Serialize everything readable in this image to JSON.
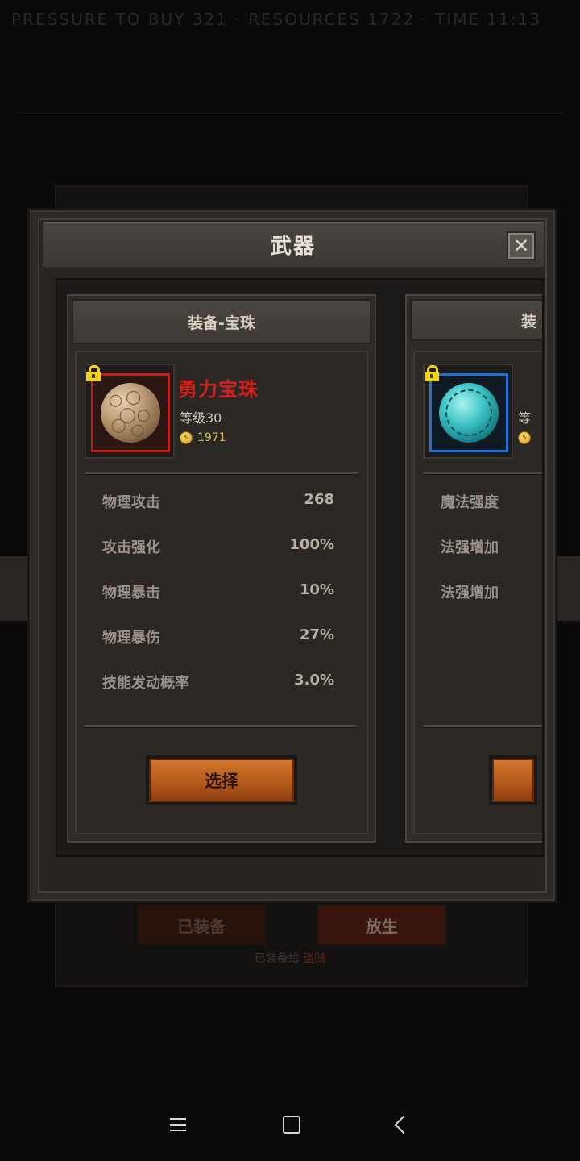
{
  "background": {
    "status_text": "PRESSURE TO BUY 321  ·  RESOURCES 1722  ·  TIME 11:13",
    "equipped_label": "已装备",
    "release_label": "放生",
    "equipped_to_prefix": "已装备给",
    "equipped_to_name": "盗贼"
  },
  "dialog": {
    "title": "武器",
    "close_glyph": "✕"
  },
  "cards": [
    {
      "header": "装备-宝珠",
      "name": "勇力宝珠",
      "level": "等级30",
      "price": "1971",
      "frame_color": "#c0201c",
      "locked": true,
      "stats": [
        {
          "label": "物理攻击",
          "value": "268"
        },
        {
          "label": "攻击强化",
          "value": "100%"
        },
        {
          "label": "物理暴击",
          "value": "10%"
        },
        {
          "label": "物理暴伤",
          "value": "27%"
        },
        {
          "label": "技能发动概率",
          "value": "3.0%"
        }
      ],
      "button": "选择"
    },
    {
      "header": "装",
      "name": "",
      "level": "等",
      "price": "",
      "frame_color": "#1f6fd6",
      "locked": true,
      "stats": [
        {
          "label": "魔法强度"
        },
        {
          "label": "法强增加"
        },
        {
          "label": "法强增加"
        }
      ]
    }
  ],
  "icons": {
    "lock": "lock-icon",
    "coin": "coin-icon",
    "close": "close-icon",
    "nav_menu": "menu-icon",
    "nav_home": "home-icon",
    "nav_back": "back-icon"
  }
}
